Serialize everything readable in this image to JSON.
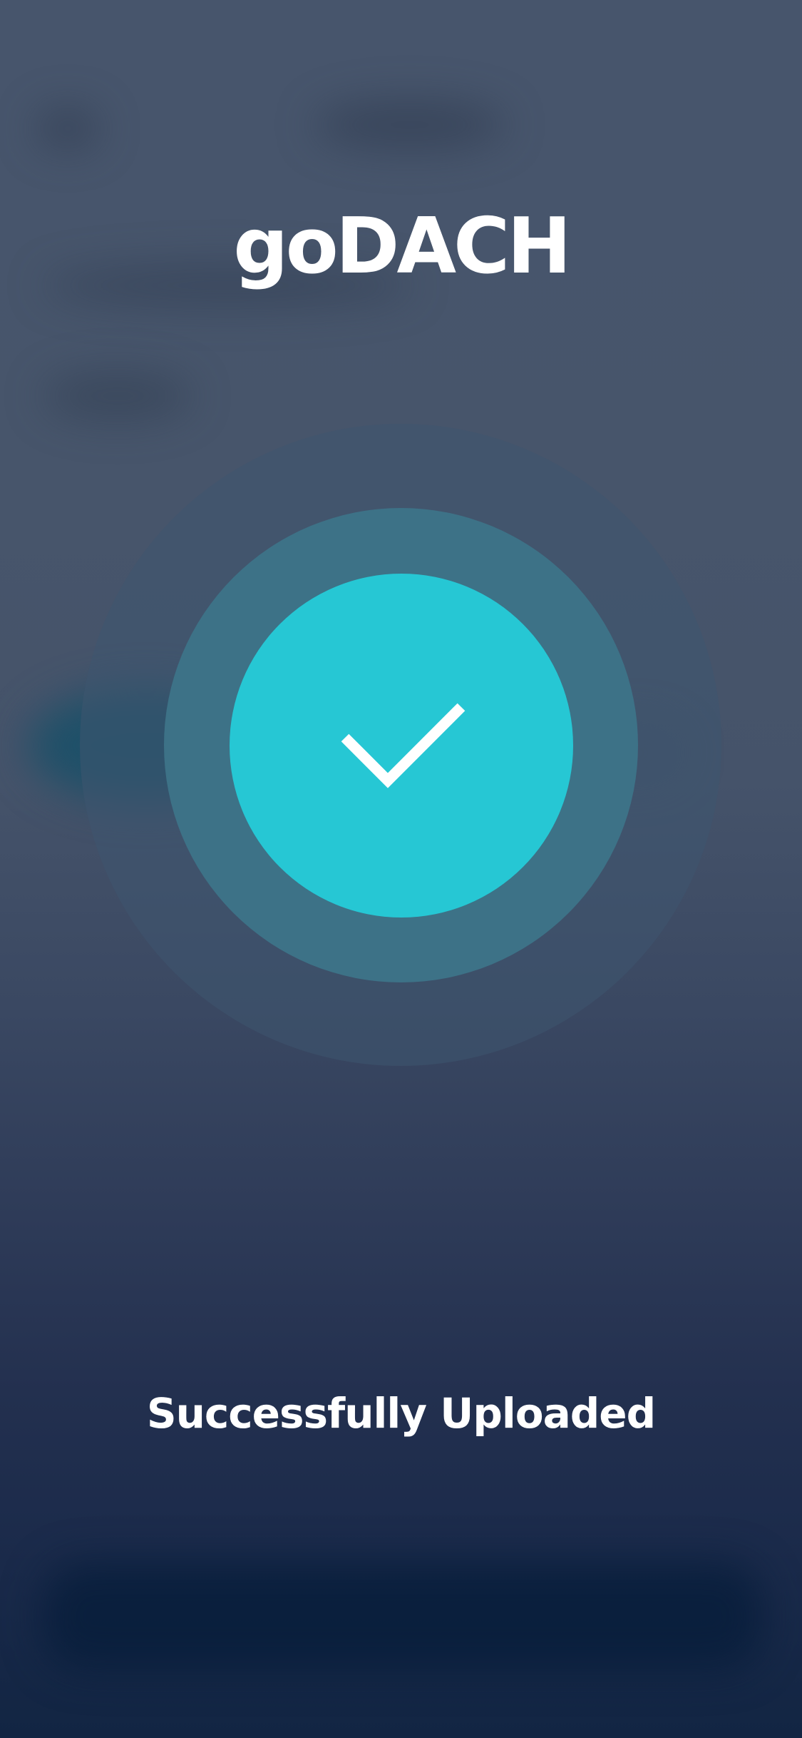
{
  "app": {
    "brand_name": "goDACH"
  },
  "upload": {
    "status_message": "Successfully Uploaded",
    "status_icon": "checkmark-icon"
  },
  "colors": {
    "accent": "#26c7d4",
    "ring_middle": "#3d7287",
    "background_top": "#47556c",
    "background_bottom": "#122543",
    "text": "#ffffff"
  }
}
